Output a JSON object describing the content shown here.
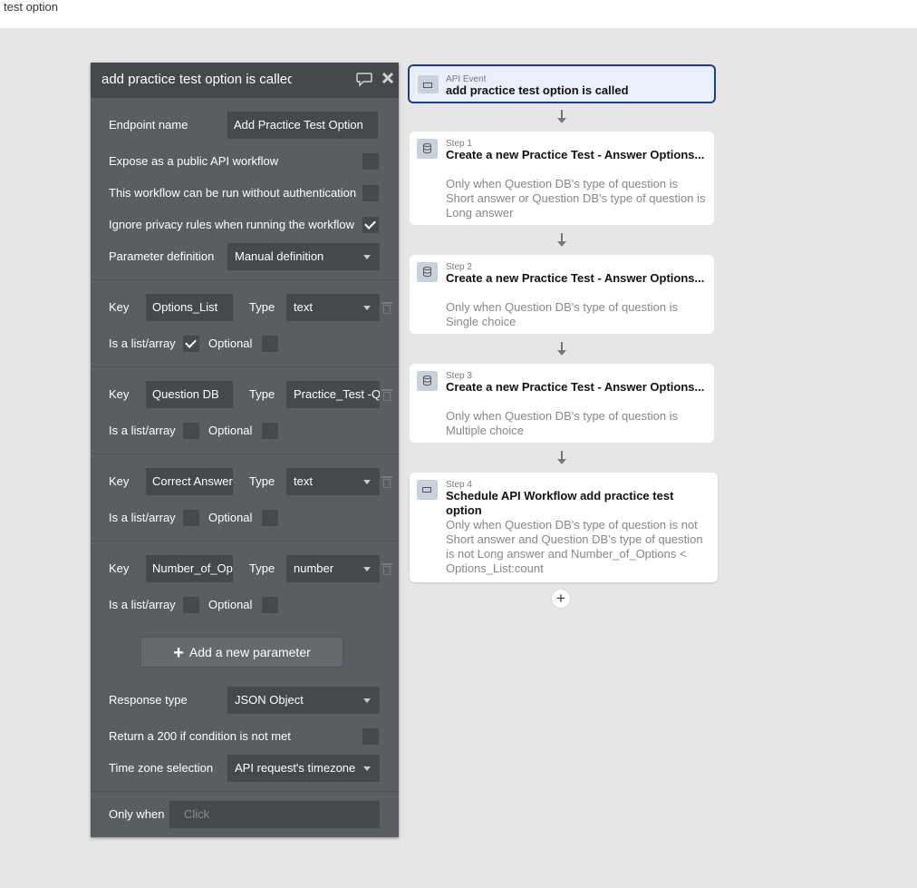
{
  "page": {
    "title": "test option"
  },
  "panel": {
    "title": "add practice test option is called",
    "endpoint_label": "Endpoint name",
    "endpoint_value": "Add Practice Test Option",
    "expose_label": "Expose as a public API workflow",
    "expose_checked": false,
    "noauth_label": "This workflow can be run without authentication",
    "noauth_checked": false,
    "ignore_label": "Ignore privacy rules when running the workflow",
    "ignore_checked": true,
    "paramdef_label": "Parameter definition",
    "paramdef_value": "Manual definition",
    "key_label": "Key",
    "type_label": "Type",
    "list_label": "Is a list/array",
    "optional_label": "Optional",
    "params": [
      {
        "key": "Options_List",
        "type": "text",
        "is_list": true,
        "optional": false
      },
      {
        "key": "Question DB",
        "type": "Practice_Test -Qu",
        "is_list": false,
        "optional": false
      },
      {
        "key": "Correct Answer",
        "type": "text",
        "is_list": false,
        "optional": false
      },
      {
        "key": "Number_of_Opt",
        "type": "number",
        "is_list": false,
        "optional": false
      }
    ],
    "add_param_label": "Add a new parameter",
    "response_label": "Response type",
    "response_value": "JSON Object",
    "return200_label": "Return a 200 if condition is not met",
    "return200_checked": false,
    "timezone_label": "Time zone selection",
    "timezone_value": "API request's timezone",
    "onlywhen_label": "Only when",
    "onlywhen_placeholder": "Click"
  },
  "flow": {
    "event": {
      "label": "API Event",
      "title": "add practice test option is called"
    },
    "steps": [
      {
        "step": "Step 1",
        "title": "Create a new Practice Test - Answer Options...",
        "condition": "Only when Question DB's type of question is Short answer or Question DB's type of question is Long answer",
        "icon": "database-icon"
      },
      {
        "step": "Step 2",
        "title": "Create a new Practice Test - Answer Options...",
        "condition": "Only when Question DB's type of question is Single choice",
        "icon": "database-icon"
      },
      {
        "step": "Step 3",
        "title": "Create a new Practice Test - Answer Options...",
        "condition": "Only when Question DB's type of question is Multiple choice",
        "icon": "database-icon"
      },
      {
        "step": "Step 4",
        "title": "Schedule API Workflow add practice test option",
        "condition": "Only when Question DB's type of question is not Short answer and Question DB's type of question is not Long answer and Number_of_Options < Options_List:count",
        "icon": "api-icon"
      }
    ]
  },
  "colors": {
    "panel_bg": "#5a5e62",
    "panel_header": "#45494d",
    "canvas_bg": "#e6e6e6",
    "event_border": "#1f3d8c",
    "event_bg": "#e8f0fc"
  }
}
